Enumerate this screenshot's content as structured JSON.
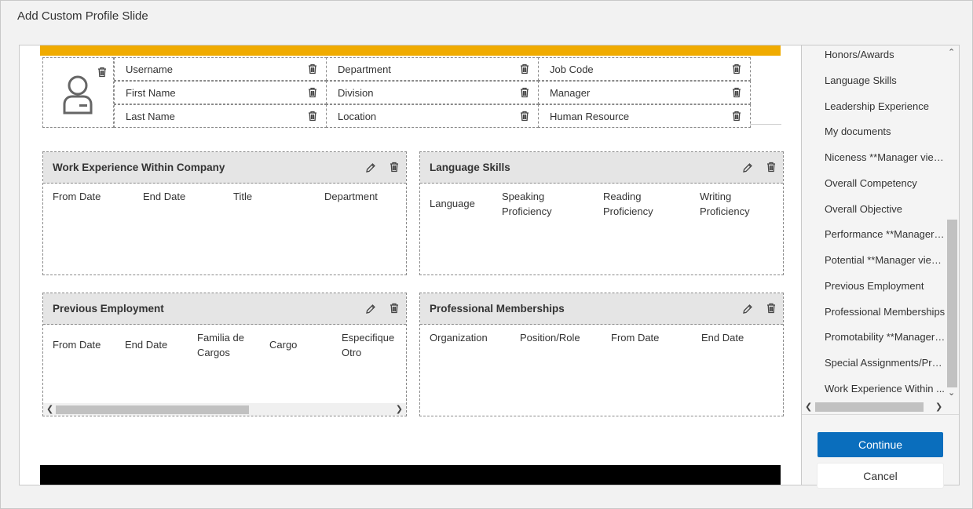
{
  "dialog": {
    "title": "Add Custom Profile Slide"
  },
  "header_fields": [
    [
      "Username",
      "Department",
      "Job Code"
    ],
    [
      "First Name",
      "Division",
      "Manager"
    ],
    [
      "Last Name",
      "Location",
      "Human Resource"
    ]
  ],
  "panels": {
    "work_experience": {
      "title": "Work Experience Within Company",
      "columns": [
        "From Date",
        "End Date",
        "Title",
        "Department"
      ]
    },
    "language_skills": {
      "title": "Language Skills",
      "columns": [
        "Language",
        "Speaking\nProficiency",
        "Reading\nProficiency",
        "Writing\nProficiency"
      ]
    },
    "previous_employment": {
      "title": "Previous Employment",
      "columns": [
        "From Date",
        "End Date",
        "Familia de\nCargos",
        "Cargo",
        "Especifique\nOtro"
      ]
    },
    "professional_memberships": {
      "title": "Professional Memberships",
      "columns": [
        "Organization",
        "Position/Role",
        "From Date",
        "End Date"
      ]
    }
  },
  "sidebar": {
    "items": [
      "Honors/Awards",
      "Language Skills",
      "Leadership Experience",
      "My documents",
      "Niceness **Manager view ...",
      "Overall Competency",
      "Overall Objective",
      "Performance **Manager vi...",
      "Potential **Manager view ...",
      "Previous Employment",
      "Professional Memberships",
      "Promotability **Manager vi...",
      "Special Assignments/Proj...",
      "Work Experience Within ..."
    ]
  },
  "buttons": {
    "continue": "Continue",
    "cancel": "Cancel"
  },
  "colors": {
    "accent": "#f0ab00",
    "primary": "#0a6ebd"
  },
  "icons": {
    "trash": "trash-icon",
    "edit": "pencil-icon",
    "avatar": "user-avatar-icon"
  }
}
